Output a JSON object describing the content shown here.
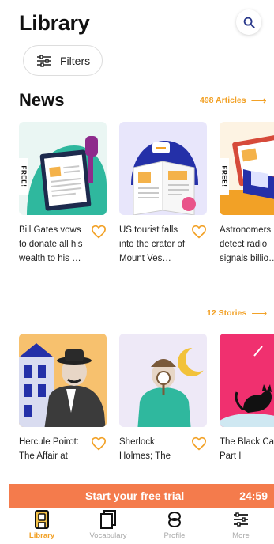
{
  "header": {
    "title": "Library"
  },
  "filters": {
    "label": "Filters"
  },
  "news": {
    "title": "News",
    "count_label": "498 Articles",
    "cards": [
      {
        "title": "Bill Gates vows to donate all his wealth to his …",
        "badge": "FREE!"
      },
      {
        "title": "US tourist falls into the crater of Mount Ves…",
        "badge": ""
      },
      {
        "title": "Astronomers detect radio signals billio…",
        "badge": "FREE!"
      }
    ]
  },
  "stories": {
    "count_label": "12 Stories",
    "cards": [
      {
        "title": "Hercule Poirot: The Affair at"
      },
      {
        "title": "Sherlock Holmes; The"
      },
      {
        "title": "The Black Cat Part I"
      }
    ]
  },
  "trial": {
    "text": "Start your free trial",
    "timer": "24:59"
  },
  "nav": {
    "active": "Library",
    "items": [
      {
        "label": "Library",
        "icon": "library-icon"
      },
      {
        "label": "Vocabulary",
        "icon": "vocabulary-icon"
      },
      {
        "label": "Profile",
        "icon": "profile-icon"
      },
      {
        "label": "More",
        "icon": "more-sliders-icon"
      }
    ]
  },
  "colors": {
    "accent": "#f2a126",
    "trial_bar": "#f47b4c",
    "heart": "#f2a126"
  }
}
